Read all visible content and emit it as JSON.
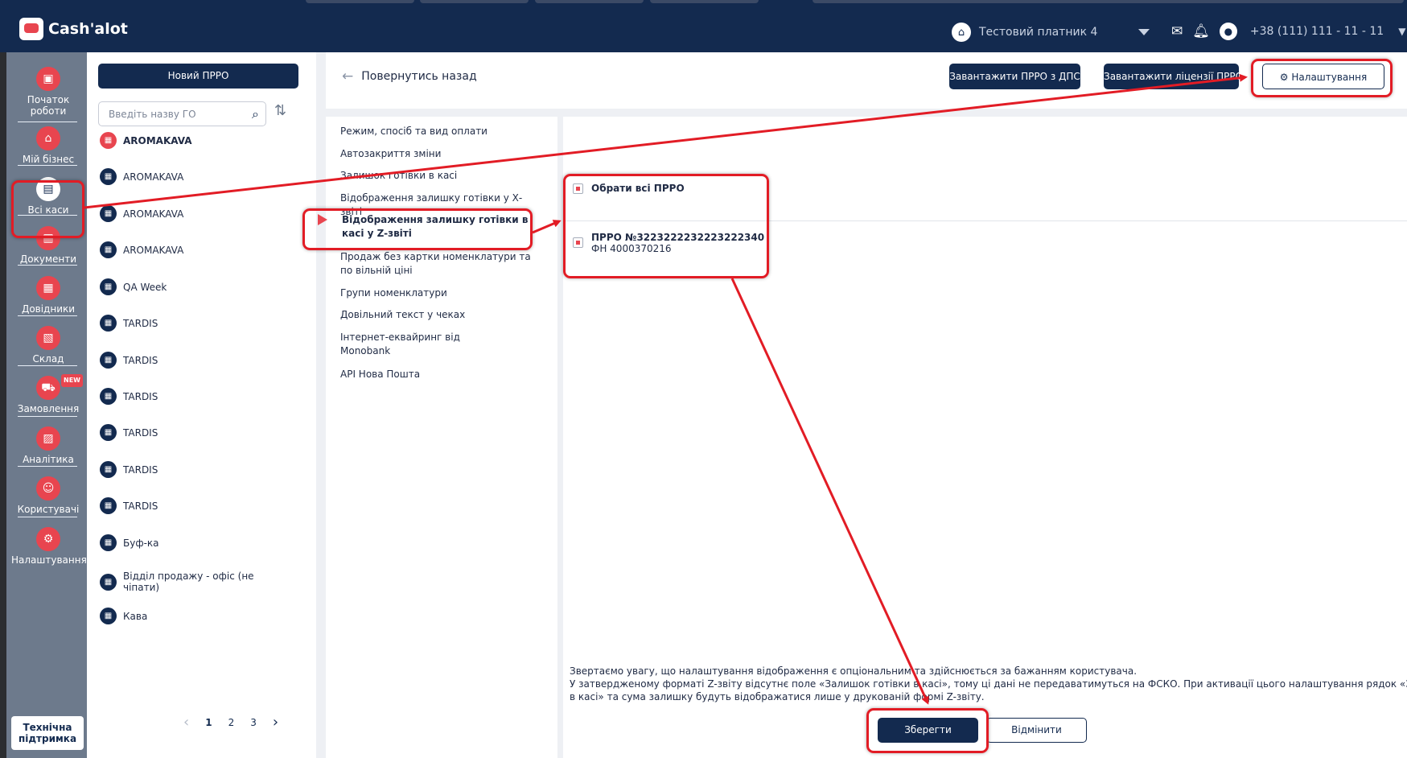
{
  "app": {
    "logo_text": "Cash'alot",
    "business_name": "Тестовий платник 4",
    "phone": "+38 (111) 111 - 11 - 11"
  },
  "nav": {
    "items": [
      {
        "label": "Початок роботи",
        "icon": "start-icon"
      },
      {
        "label": "Мій бізнес",
        "icon": "home-icon"
      },
      {
        "label": "Всі каси",
        "icon": "cash-register-icon"
      },
      {
        "label": "Документи",
        "icon": "documents-icon"
      },
      {
        "label": "Довідники",
        "icon": "reference-icon"
      },
      {
        "label": "Склад",
        "icon": "warehouse-icon"
      },
      {
        "label": "Замовлення",
        "icon": "orders-icon",
        "badge": "NEW"
      },
      {
        "label": "Аналітика",
        "icon": "analytics-icon"
      },
      {
        "label": "Користувачі",
        "icon": "users-icon"
      },
      {
        "label": "Налаштування",
        "icon": "gear-icon"
      }
    ],
    "support_label": "Технічна підтримка"
  },
  "list": {
    "new_button": "Новий ПРРО",
    "search_placeholder": "Введіть назву ГО",
    "items": [
      "AROMAKAVA",
      "AROMAKAVA",
      "AROMAKAVA",
      "AROMAKAVA",
      "QA Week",
      "TARDIS",
      "TARDIS",
      "TARDIS",
      "TARDIS",
      "TARDIS",
      "TARDIS",
      "Буф-ка",
      "Відділ продажу - офіс (не чіпати)",
      "Кава"
    ],
    "pages": [
      "1",
      "2",
      "3"
    ]
  },
  "header": {
    "back_label": "Повернутись назад",
    "btn_download_dps": "Завантажити ПРРО з ДПС",
    "btn_download_license": "Завантажити ліцензії ПРРО",
    "btn_settings": "Налаштування"
  },
  "settings_menu": {
    "items": [
      "Режим, спосіб та вид оплати",
      "Автозакриття зміни",
      "Залишок готівки в касі",
      "Відображення залишку готівки у Х-звіті",
      "Відображення залишку готівки в касі у Z-звіті",
      "Продаж без картки номенклатури та по вільній ціні",
      "Групи номенклатури",
      "Довільний текст у чеках",
      "Інтернет-еквайринг від Monobank",
      "API Нова Пошта"
    ],
    "active_index": 4
  },
  "content": {
    "select_all": "Обрати всі ПРРО",
    "prro_title": "ПРРО №3223222232223222340",
    "prro_fn": "ФН 4000370216",
    "note_line1": "Звертаємо увагу, що налаштування відображення є опціональним та здійснюється за бажанням користувача.",
    "note_line2": "У затвердженому форматі Z-звіту відсутнє поле «Залишок готівки в касі», тому ці дані не передаватимуться на ФСКО. При активації цього налаштування рядок «Залишок готівки",
    "note_line3": "в касі» та сума залишку будуть відображатися лише у друкованій формі Z-звіту.",
    "save_label": "Зберегти",
    "cancel_label": "Відмінити"
  },
  "colors": {
    "navy": "#132a4f",
    "accent_red": "#e8454f",
    "annotation_red": "#e21c25",
    "nav_gray": "#6d7a8c"
  }
}
